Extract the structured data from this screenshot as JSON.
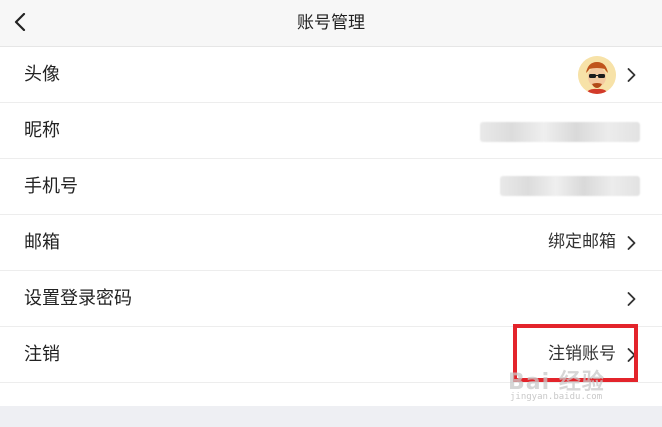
{
  "header": {
    "title": "账号管理"
  },
  "rows": [
    {
      "label": "头像",
      "value": ""
    },
    {
      "label": "昵称",
      "value": ""
    },
    {
      "label": "手机号",
      "value": ""
    },
    {
      "label": "邮箱",
      "value": "绑定邮箱"
    },
    {
      "label": "设置登录密码",
      "value": ""
    },
    {
      "label": "注销",
      "value": "注销账号"
    }
  ],
  "watermark": {
    "logo": "Bai 经验",
    "url": "jingyan.baidu.com"
  },
  "colors": {
    "highlight": "#e3242b",
    "footer": "#eeeff3"
  }
}
